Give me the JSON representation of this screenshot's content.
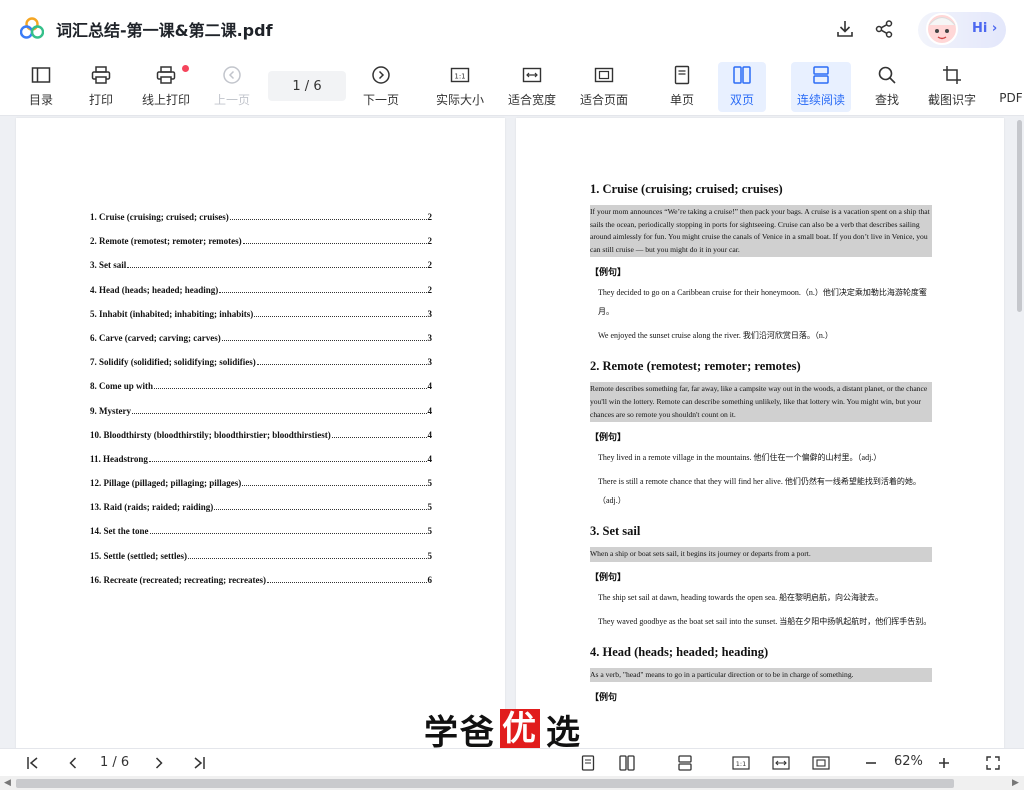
{
  "window": {
    "title": "词汇总结-第一课&第二课.pdf",
    "hi_label": "Hi"
  },
  "toolbar": {
    "toc": "目录",
    "print": "打印",
    "online_print": "线上打印",
    "prev_page": "上一页",
    "page_indicator": "1 / 6",
    "next_page": "下一页",
    "actual_size": "实际大小",
    "fit_width": "适合宽度",
    "fit_page": "适合页面",
    "single_page": "单页",
    "double_page": "双页",
    "continuous": "连续阅读",
    "find": "查找",
    "screenshot_ocr": "截图识字",
    "pdf_more": "PDF"
  },
  "toc": [
    {
      "title": "1. Cruise (cruising; cruised; cruises)",
      "page": "2"
    },
    {
      "title": "2. Remote (remotest; remoter; remotes)",
      "page": "2"
    },
    {
      "title": "3. Set sail",
      "page": "2"
    },
    {
      "title": "4. Head (heads; headed; heading)",
      "page": "2"
    },
    {
      "title": "5. Inhabit (inhabited; inhabiting; inhabits)",
      "page": "3"
    },
    {
      "title": "6. Carve (carved; carving; carves)",
      "page": "3"
    },
    {
      "title": "7. Solidify (solidified; solidifying; solidifies)",
      "page": "3"
    },
    {
      "title": "8. Come up with",
      "page": "4"
    },
    {
      "title": "9. Mystery",
      "page": "4"
    },
    {
      "title": "10. Bloodthirsty (bloodthirstily; bloodthirstier; bloodthirstiest)",
      "page": "4"
    },
    {
      "title": "11. Headstrong",
      "page": "4"
    },
    {
      "title": "12. Pillage (pillaged; pillaging; pillages)",
      "page": "5"
    },
    {
      "title": "13. Raid (raids; raided; raiding)",
      "page": "5"
    },
    {
      "title": "14. Set the tone",
      "page": "5"
    },
    {
      "title": "15. Settle (settled; settles)",
      "page": "5"
    },
    {
      "title": "16. Recreate (recreated; recreating; recreates)",
      "page": "6"
    }
  ],
  "entries": {
    "example_heading": "【例句】",
    "e1": {
      "heading": "1.  Cruise (cruising; cruised; cruises)",
      "definition": "If your mom announces “We’re taking a cruise!” then pack your bags. A cruise is a vacation spent on a ship that sails the ocean, periodically stopping in ports for sightseeing. Cruise can also be a verb that describes sailing around aimlessly for fun. You might cruise the canals of Venice in a small boat. If you don’t live in Venice, you can still cruise — but you might do it in your car.",
      "ex1": "They decided to go on a Caribbean cruise for their honeymoon.（n.）他们决定乘加勒比海游轮度蜜月。",
      "ex2": "We enjoyed the sunset cruise along the river. 我们沿河欣赏日落。（n.）"
    },
    "e2": {
      "heading": "2.  Remote (remotest; remoter; remotes)",
      "definition": "Remote describes something far, far away, like a campsite way out in the woods, a distant planet, or the chance you'll win the lottery. Remote can describe something unlikely, like that lottery win. You might win, but your chances are so remote you shouldn't count on it.",
      "ex1": "They lived in a remote village in the mountains. 他们住在一个偏僻的山村里。（adj.）",
      "ex2": "There is still a remote chance that they will find her alive. 他们仍然有一线希望能找到活着的她。（adj.）"
    },
    "e3": {
      "heading": "3.  Set sail",
      "definition": "When a ship or boat sets sail, it begins its journey or departs from a port.",
      "ex1": "The ship set sail at dawn, heading towards the open sea. 船在黎明启航，向公海驶去。",
      "ex2": "They waved goodbye as the boat set sail into the sunset. 当船在夕阳中扬帆起航时，他们挥手告别。"
    },
    "e4": {
      "heading": "4.  Head (heads; headed; heading)",
      "definition": "As a verb, \"head\" means to go in a particular direction or to be in charge of something.",
      "ex_partial": "【例句"
    }
  },
  "bottombar": {
    "page_indicator": "1 / 6",
    "zoom": "62%"
  },
  "watermark": {
    "left": "学爸",
    "red": "优",
    "right": "选"
  }
}
